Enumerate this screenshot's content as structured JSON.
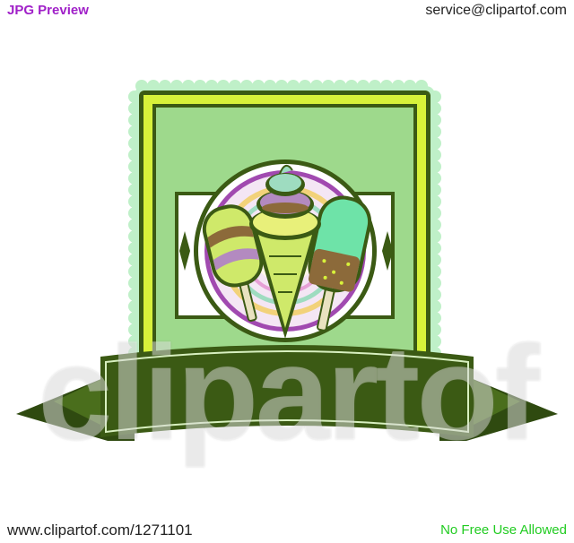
{
  "header": {
    "preview_label": "JPG Preview",
    "contact_email": "service@clipartof.com"
  },
  "footer": {
    "site_url": "www.clipartof.com/1271101",
    "license_note": "No Free Use Allowed"
  },
  "watermark": {
    "text": "clipartof"
  },
  "colors": {
    "preview_label": "#a020c8",
    "license_note": "#22cc22",
    "dark_green": "#3b5a14",
    "light_green": "#9ed98c",
    "lime": "#d8f23a",
    "purple": "#a14ab0",
    "mint": "#6ee3a8"
  },
  "icons": [
    "ice-cream-cone-icon",
    "popsicle-icon",
    "ice-cream-bar-icon",
    "diamond-ornament-icon",
    "ribbon-banner-icon"
  ]
}
